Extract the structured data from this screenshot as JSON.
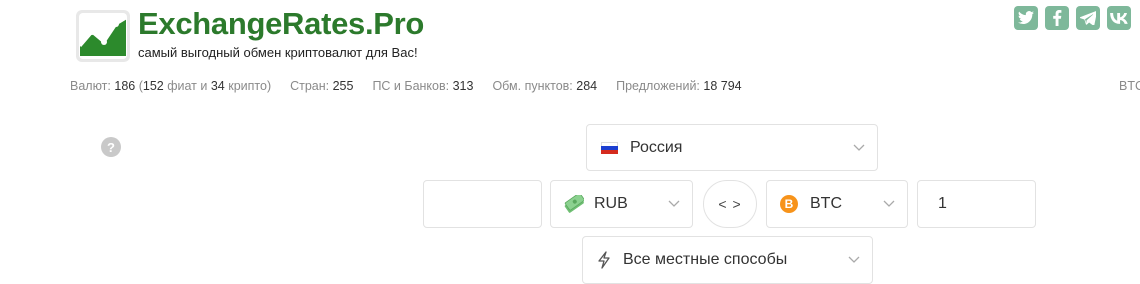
{
  "header": {
    "brand": "ExchangeRates.Pro",
    "tagline": "самый выгодный обмен криптовалют для Вас!",
    "social": [
      "twitter-icon",
      "facebook-icon",
      "telegram-icon",
      "vk-icon"
    ]
  },
  "stats": {
    "currencies_label": "Валют:",
    "currencies_value": "186",
    "fiat_value": "152",
    "fiat_label": "фиат и",
    "crypto_value": "34",
    "crypto_label": "крипто)",
    "countries_label": "Стран:",
    "countries_value": "255",
    "banks_label": "ПС и Банков:",
    "banks_value": "313",
    "points_label": "Обм. пунктов:",
    "points_value": "284",
    "offers_label": "Предложений:",
    "offers_value": "18 794",
    "ticker_cut": "BTC"
  },
  "form": {
    "help": "?",
    "country": "Россия",
    "amount_from": "",
    "currency_from": "RUB",
    "swap_label": "< >",
    "currency_to": "BTC",
    "amount_to": "1",
    "method": "Все местные способы"
  },
  "colors": {
    "brand_green": "#2c7a2c",
    "social_green": "#7eb89a",
    "bitcoin_orange": "#f7931a"
  }
}
